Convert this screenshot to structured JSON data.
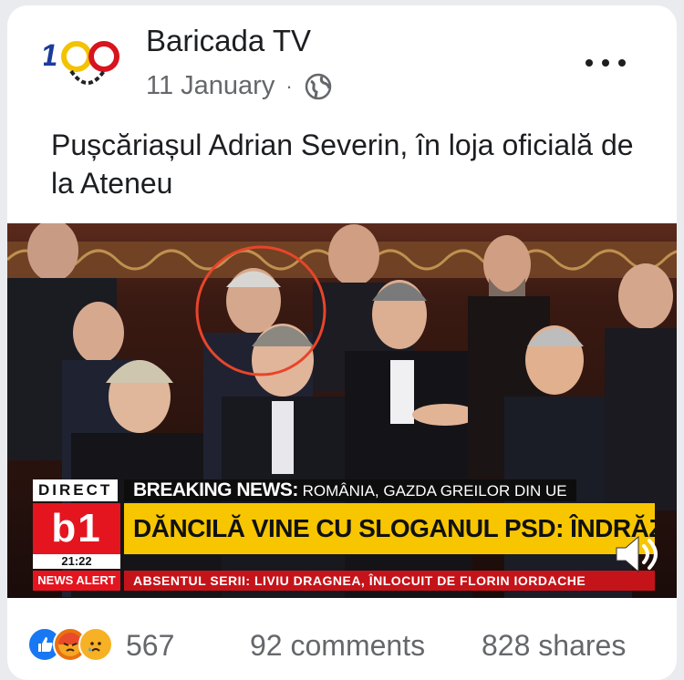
{
  "post": {
    "page_name": "Baricada TV",
    "date": "11 January",
    "separator": "·",
    "privacy_icon": "globe-icon",
    "more_icon": "more-options-icon",
    "text": "Pușcăriașul Adrian Severin, în loja oficială de la Ateneu"
  },
  "video": {
    "ticker_direct": "DIRECT",
    "ticker_breaking_label": "BREAKING NEWS:",
    "ticker_breaking_text": "ROMÂNIA, GAZDA GREILOR DIN UE",
    "channel_logo": "b1",
    "time": "21:22",
    "headline": "DĂNCILĂ VINE CU SLOGANUL PSD: ÎNDRĂZNIȚI SĂ CREDEȚI",
    "news_alert": "NEWS ALERT",
    "subline": "ABSENTUL SERII: LIVIU DRAGNEA, ÎNLOCUIT DE FLORIN IORDACHE",
    "sound_icon": "volume-icon"
  },
  "footer": {
    "reactions": [
      "like-icon",
      "angry-icon",
      "sad-icon"
    ],
    "reaction_count": "567",
    "comments": "92 comments",
    "shares": "828 shares"
  },
  "colors": {
    "like_blue": "#1877f2",
    "angry_orange": "#e9710f",
    "sad_yellow": "#f7b125",
    "b1_red": "#e4151f",
    "headline_yellow": "#f7c600"
  }
}
